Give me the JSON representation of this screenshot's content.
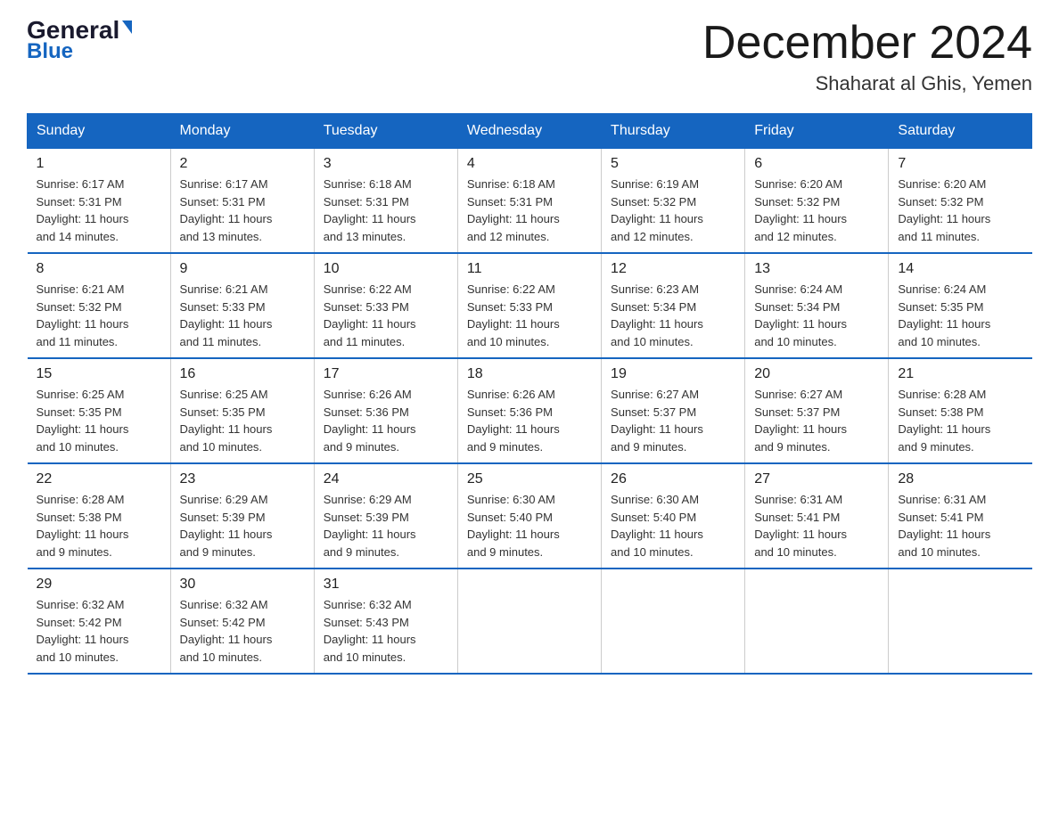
{
  "header": {
    "logo_general": "General",
    "logo_blue": "Blue",
    "month_title": "December 2024",
    "location": "Shaharat al Ghis, Yemen"
  },
  "days_of_week": [
    "Sunday",
    "Monday",
    "Tuesday",
    "Wednesday",
    "Thursday",
    "Friday",
    "Saturday"
  ],
  "weeks": [
    [
      {
        "day": "1",
        "info": "Sunrise: 6:17 AM\nSunset: 5:31 PM\nDaylight: 11 hours\nand 14 minutes."
      },
      {
        "day": "2",
        "info": "Sunrise: 6:17 AM\nSunset: 5:31 PM\nDaylight: 11 hours\nand 13 minutes."
      },
      {
        "day": "3",
        "info": "Sunrise: 6:18 AM\nSunset: 5:31 PM\nDaylight: 11 hours\nand 13 minutes."
      },
      {
        "day": "4",
        "info": "Sunrise: 6:18 AM\nSunset: 5:31 PM\nDaylight: 11 hours\nand 12 minutes."
      },
      {
        "day": "5",
        "info": "Sunrise: 6:19 AM\nSunset: 5:32 PM\nDaylight: 11 hours\nand 12 minutes."
      },
      {
        "day": "6",
        "info": "Sunrise: 6:20 AM\nSunset: 5:32 PM\nDaylight: 11 hours\nand 12 minutes."
      },
      {
        "day": "7",
        "info": "Sunrise: 6:20 AM\nSunset: 5:32 PM\nDaylight: 11 hours\nand 11 minutes."
      }
    ],
    [
      {
        "day": "8",
        "info": "Sunrise: 6:21 AM\nSunset: 5:32 PM\nDaylight: 11 hours\nand 11 minutes."
      },
      {
        "day": "9",
        "info": "Sunrise: 6:21 AM\nSunset: 5:33 PM\nDaylight: 11 hours\nand 11 minutes."
      },
      {
        "day": "10",
        "info": "Sunrise: 6:22 AM\nSunset: 5:33 PM\nDaylight: 11 hours\nand 11 minutes."
      },
      {
        "day": "11",
        "info": "Sunrise: 6:22 AM\nSunset: 5:33 PM\nDaylight: 11 hours\nand 10 minutes."
      },
      {
        "day": "12",
        "info": "Sunrise: 6:23 AM\nSunset: 5:34 PM\nDaylight: 11 hours\nand 10 minutes."
      },
      {
        "day": "13",
        "info": "Sunrise: 6:24 AM\nSunset: 5:34 PM\nDaylight: 11 hours\nand 10 minutes."
      },
      {
        "day": "14",
        "info": "Sunrise: 6:24 AM\nSunset: 5:35 PM\nDaylight: 11 hours\nand 10 minutes."
      }
    ],
    [
      {
        "day": "15",
        "info": "Sunrise: 6:25 AM\nSunset: 5:35 PM\nDaylight: 11 hours\nand 10 minutes."
      },
      {
        "day": "16",
        "info": "Sunrise: 6:25 AM\nSunset: 5:35 PM\nDaylight: 11 hours\nand 10 minutes."
      },
      {
        "day": "17",
        "info": "Sunrise: 6:26 AM\nSunset: 5:36 PM\nDaylight: 11 hours\nand 9 minutes."
      },
      {
        "day": "18",
        "info": "Sunrise: 6:26 AM\nSunset: 5:36 PM\nDaylight: 11 hours\nand 9 minutes."
      },
      {
        "day": "19",
        "info": "Sunrise: 6:27 AM\nSunset: 5:37 PM\nDaylight: 11 hours\nand 9 minutes."
      },
      {
        "day": "20",
        "info": "Sunrise: 6:27 AM\nSunset: 5:37 PM\nDaylight: 11 hours\nand 9 minutes."
      },
      {
        "day": "21",
        "info": "Sunrise: 6:28 AM\nSunset: 5:38 PM\nDaylight: 11 hours\nand 9 minutes."
      }
    ],
    [
      {
        "day": "22",
        "info": "Sunrise: 6:28 AM\nSunset: 5:38 PM\nDaylight: 11 hours\nand 9 minutes."
      },
      {
        "day": "23",
        "info": "Sunrise: 6:29 AM\nSunset: 5:39 PM\nDaylight: 11 hours\nand 9 minutes."
      },
      {
        "day": "24",
        "info": "Sunrise: 6:29 AM\nSunset: 5:39 PM\nDaylight: 11 hours\nand 9 minutes."
      },
      {
        "day": "25",
        "info": "Sunrise: 6:30 AM\nSunset: 5:40 PM\nDaylight: 11 hours\nand 9 minutes."
      },
      {
        "day": "26",
        "info": "Sunrise: 6:30 AM\nSunset: 5:40 PM\nDaylight: 11 hours\nand 10 minutes."
      },
      {
        "day": "27",
        "info": "Sunrise: 6:31 AM\nSunset: 5:41 PM\nDaylight: 11 hours\nand 10 minutes."
      },
      {
        "day": "28",
        "info": "Sunrise: 6:31 AM\nSunset: 5:41 PM\nDaylight: 11 hours\nand 10 minutes."
      }
    ],
    [
      {
        "day": "29",
        "info": "Sunrise: 6:32 AM\nSunset: 5:42 PM\nDaylight: 11 hours\nand 10 minutes."
      },
      {
        "day": "30",
        "info": "Sunrise: 6:32 AM\nSunset: 5:42 PM\nDaylight: 11 hours\nand 10 minutes."
      },
      {
        "day": "31",
        "info": "Sunrise: 6:32 AM\nSunset: 5:43 PM\nDaylight: 11 hours\nand 10 minutes."
      },
      {
        "day": "",
        "info": ""
      },
      {
        "day": "",
        "info": ""
      },
      {
        "day": "",
        "info": ""
      },
      {
        "day": "",
        "info": ""
      }
    ]
  ]
}
